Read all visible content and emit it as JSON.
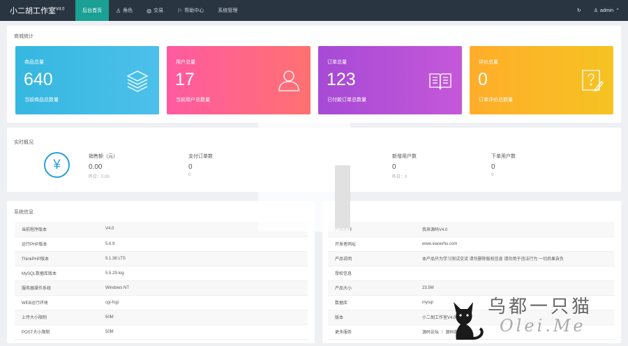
{
  "topbar": {
    "brand": "小二胡工作室",
    "version": "V4.0",
    "nav": [
      {
        "label": "后台首页",
        "icon": "",
        "active": true
      },
      {
        "label": "角色",
        "icon": "user-icon",
        "active": false
      },
      {
        "label": "交易",
        "icon": "globe-icon",
        "active": false
      },
      {
        "label": "帮助中心",
        "icon": "flag-icon",
        "active": false
      },
      {
        "label": "系统管理",
        "icon": "",
        "active": false
      }
    ],
    "user": "admin"
  },
  "stats": {
    "title": "商城统计",
    "cards": [
      {
        "label": "商品总量",
        "value": "640",
        "sub": "当前商品总数量",
        "icon": "layers-icon"
      },
      {
        "label": "用户总量",
        "value": "17",
        "sub": "当前用户总数量",
        "icon": "user-icon"
      },
      {
        "label": "订单总量",
        "value": "123",
        "sub": "已付款订单总数量",
        "icon": "book-icon"
      },
      {
        "label": "评价总量",
        "value": "0",
        "sub": "订单评价总数量",
        "icon": "comment-edit-icon"
      }
    ]
  },
  "realtime": {
    "title": "实时概况",
    "metrics": [
      {
        "label": "销售额（元）",
        "value": "0.00",
        "yesterday": "昨日：0.00"
      },
      {
        "label": "支付订单数",
        "value": "0",
        "yesterday": "0"
      },
      {
        "label": "新增用户数",
        "value": "0",
        "yesterday": "昨日：0"
      },
      {
        "label": "下单用户数",
        "value": "0",
        "yesterday": "0"
      }
    ]
  },
  "system": {
    "title": "系统信息",
    "rows": [
      {
        "key": "当前程序版本",
        "value": "V4.0"
      },
      {
        "key": "运行PHP版本",
        "value": "5.6.9"
      },
      {
        "key": "ThinkPHP版本",
        "value": "5.1.38 LTS"
      },
      {
        "key": "MySQL数据库版本",
        "value": "5.5.29-log"
      },
      {
        "key": "服务器操作系统",
        "value": "Windows NT"
      },
      {
        "key": "WEB运行环境",
        "value": "cgi-fcgi"
      },
      {
        "key": "上传大小限制",
        "value": "50M"
      },
      {
        "key": "POST大小限制",
        "value": "50M"
      }
    ]
  },
  "dev": {
    "rows": [
      {
        "key": "产品名称",
        "value": "我来源码V4.0"
      },
      {
        "key": "开发者网址",
        "value": "www.xiaoerhu.com"
      },
      {
        "key": "产品说明",
        "value": "本产品只为学习测试交流 请勿删除版权信息 请勿用于违法行为 一切后果自负"
      },
      {
        "key": "授权信息",
        "value": ""
      },
      {
        "key": "产品大小",
        "value": "23.5M"
      },
      {
        "key": "数据库",
        "value": "mysql"
      },
      {
        "key": "版本",
        "value": "小二胡工作室V4.0"
      },
      {
        "key": "更多服务",
        "value": "源码论坛 ｜ 源码商城"
      }
    ]
  },
  "watermark": {
    "cn": "乌都一只猫",
    "en": "Olei.Me"
  }
}
